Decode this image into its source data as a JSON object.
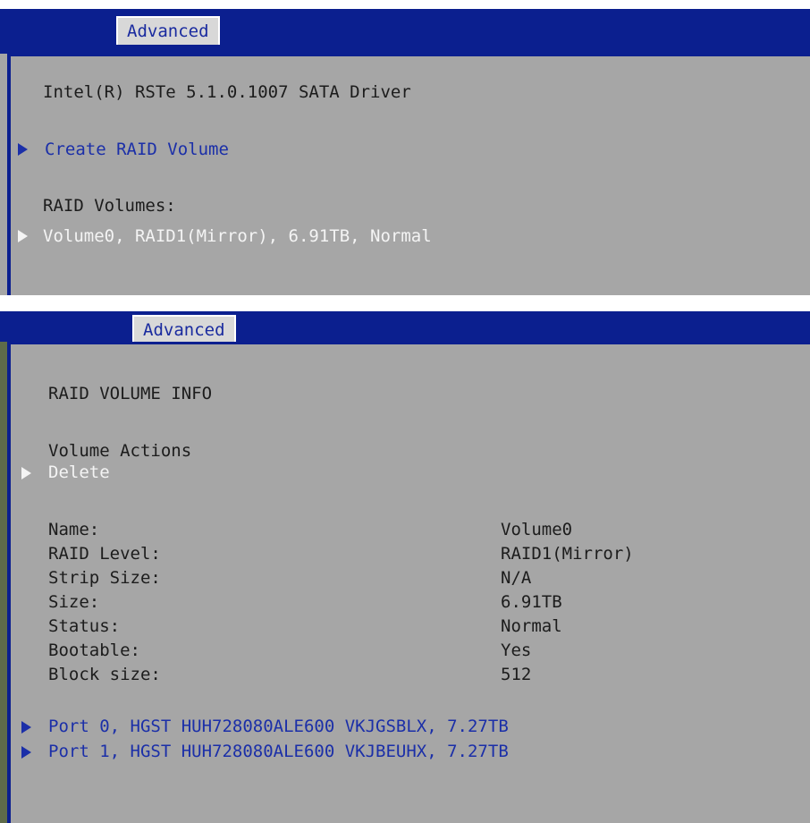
{
  "panel1": {
    "tab": "Advanced",
    "driver_title": "Intel(R) RSTe 5.1.0.1007 SATA Driver",
    "create_raid": "Create RAID Volume",
    "raid_volumes_heading": "RAID Volumes:",
    "volume_entry": "Volume0, RAID1(Mirror), 6.91TB, Normal"
  },
  "panel2": {
    "tab": "Advanced",
    "heading": "RAID VOLUME INFO",
    "actions_heading": "Volume Actions",
    "delete": "Delete",
    "info": [
      {
        "label": "Name:",
        "value": "Volume0"
      },
      {
        "label": "RAID Level:",
        "value": "RAID1(Mirror)"
      },
      {
        "label": "Strip Size:",
        "value": "N/A"
      },
      {
        "label": "Size:",
        "value": "6.91TB"
      },
      {
        "label": "Status:",
        "value": "Normal"
      },
      {
        "label": "Bootable:",
        "value": "Yes"
      },
      {
        "label": "Block size:",
        "value": "512"
      }
    ],
    "ports": [
      "Port 0, HGST HUH728080ALE600 VKJGSBLX, 7.27TB",
      "Port 1, HGST HUH728080ALE600 VKJBEUHX, 7.27TB"
    ]
  },
  "colors": {
    "header_blue": "#0b1f8f",
    "panel_gray": "#a6a6a6",
    "link_blue": "#1b2fa8",
    "highlight_white": "#f4f4f4"
  },
  "icons": [
    "submenu-arrow-icon"
  ]
}
